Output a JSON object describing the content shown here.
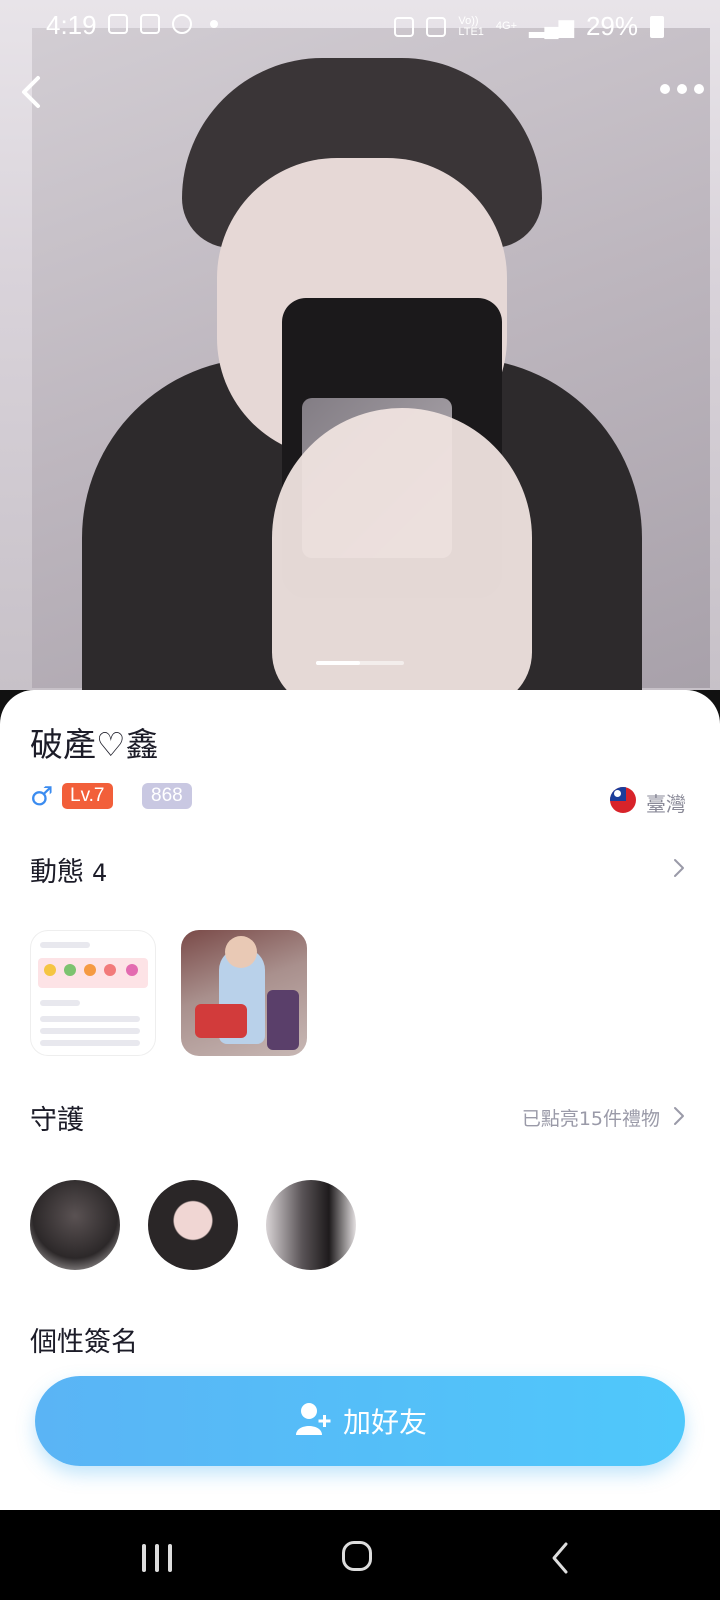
{
  "status_bar": {
    "time": "4:19",
    "network_top": "Vo))",
    "network_bottom": "LTE1",
    "data_type": "4G+",
    "battery": "29%"
  },
  "profile": {
    "name": "破產♡鑫",
    "gender_symbol": "♂",
    "level": "Lv.7",
    "badge_number": "868",
    "region": "臺灣"
  },
  "posts_section": {
    "title": "動態",
    "count": "4"
  },
  "guard_section": {
    "title": "守護",
    "summary": "已點亮15件禮物"
  },
  "signature_section": {
    "title": "個性簽名"
  },
  "actions": {
    "add_friend": "加好友"
  },
  "colors": {
    "accent_blue": "#4fc8fb",
    "level_orange": "#f25f3a",
    "badge_lilac": "#c9c8e2"
  },
  "icons": [
    "back-icon",
    "more-icon",
    "male-icon",
    "flag-icon",
    "chevron-right-icon",
    "add-user-icon"
  ]
}
